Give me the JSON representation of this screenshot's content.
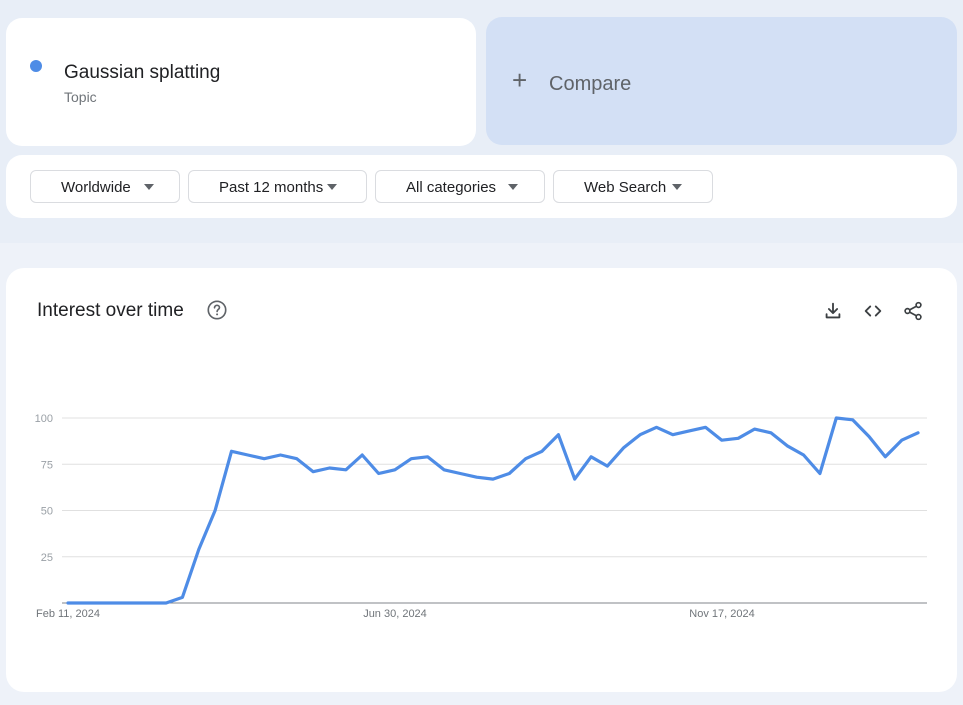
{
  "term": {
    "name": "Gaussian splatting",
    "type": "Topic",
    "color": "#4e8ce6"
  },
  "compare": {
    "plus": "+",
    "label": "Compare"
  },
  "filters": {
    "region": "Worldwide",
    "time": "Past 12 months",
    "category": "All categories",
    "property": "Web Search"
  },
  "chart": {
    "title": "Interest over time",
    "icons": [
      "help-icon",
      "download-icon",
      "embed-icon",
      "share-icon"
    ]
  },
  "chart_data": {
    "type": "line",
    "title": "Interest over time",
    "xlabel": "",
    "ylabel": "",
    "ylim": [
      0,
      100
    ],
    "y_ticks": [
      "100",
      "75",
      "50",
      "25"
    ],
    "x_tick_labels": [
      "Feb 11, 2024",
      "Jun 30, 2024",
      "Nov 17, 2024"
    ],
    "grid": true,
    "series": [
      {
        "color": "#4e8ce6",
        "values": [
          0,
          0,
          0,
          0,
          0,
          0,
          0,
          3,
          29,
          50,
          82,
          80,
          78,
          80,
          78,
          71,
          73,
          72,
          80,
          70,
          72,
          78,
          79,
          72,
          70,
          68,
          67,
          70,
          78,
          82,
          91,
          67,
          79,
          74,
          84,
          91,
          95,
          91,
          93,
          95,
          88,
          89,
          94,
          92,
          85,
          80,
          70,
          100,
          99,
          90,
          79,
          88,
          92
        ]
      }
    ]
  }
}
